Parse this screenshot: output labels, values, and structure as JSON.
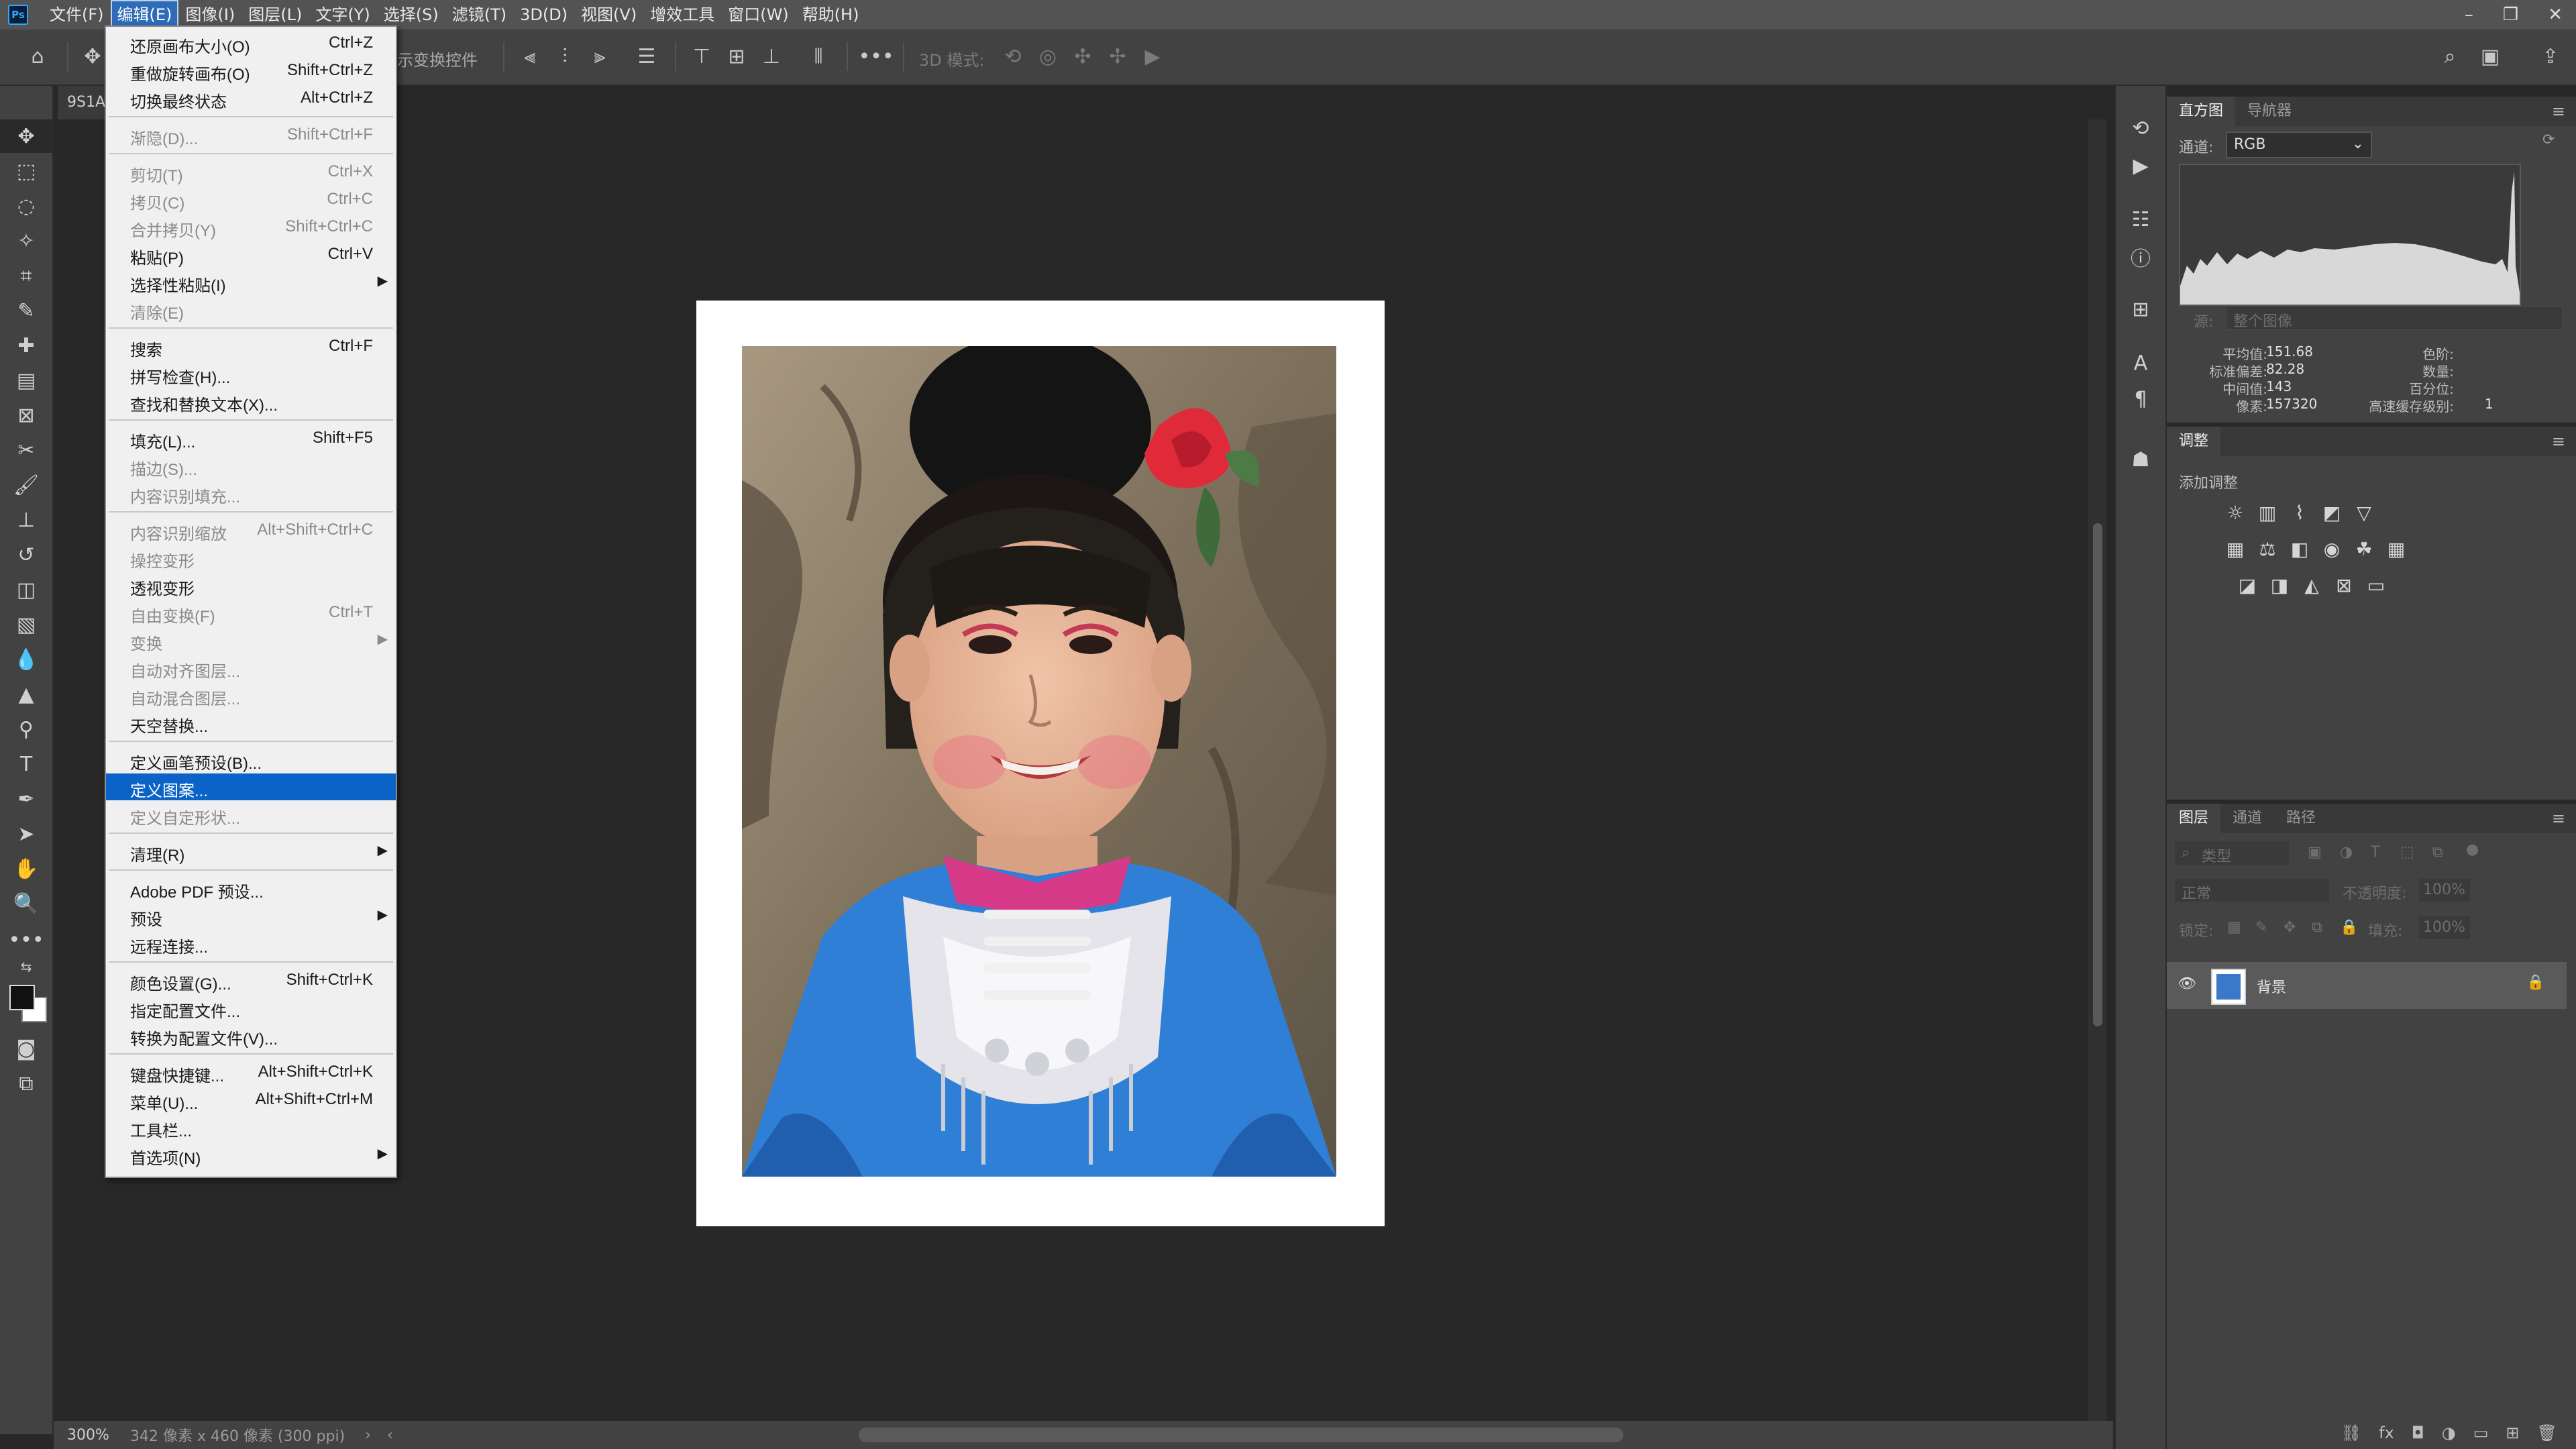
{
  "menubar": {
    "items": [
      "文件(F)",
      "编辑(E)",
      "图像(I)",
      "图层(L)",
      "文字(Y)",
      "选择(S)",
      "滤镜(T)",
      "3D(D)",
      "视图(V)",
      "增效工具",
      "窗口(W)",
      "帮助(H)"
    ],
    "active_index": 1
  },
  "options_bar": {
    "transform_controls_label": "示变换控件",
    "mode_3d_label": "3D 模式:"
  },
  "document": {
    "tab_label": "9S1A"
  },
  "status": {
    "zoom": "300%",
    "info": "342 像素 x 460 像素 (300 ppi)"
  },
  "histogram": {
    "tabs": [
      "直方图",
      "导航器"
    ],
    "channel_label": "通道:",
    "channel_value": "RGB",
    "source_label": "源:",
    "source_value": "整个图像",
    "stats_left": [
      {
        "label": "平均值:",
        "value": "151.68"
      },
      {
        "label": "标准偏差:",
        "value": "82.28"
      },
      {
        "label": "中间值:",
        "value": "143"
      },
      {
        "label": "像素:",
        "value": "157320"
      }
    ],
    "stats_right": [
      {
        "label": "色阶:",
        "value": ""
      },
      {
        "label": "数量:",
        "value": ""
      },
      {
        "label": "百分位:",
        "value": ""
      },
      {
        "label": "高速缓存级别:",
        "value": "1"
      }
    ]
  },
  "adjustments": {
    "title": "调整",
    "add_label": "添加调整"
  },
  "layers": {
    "tabs": [
      "图层",
      "通道",
      "路径"
    ],
    "filter_placeholder": "类型",
    "blend_mode": "正常",
    "opacity_label": "不透明度:",
    "opacity_value": "100%",
    "lock_label": "锁定:",
    "fill_label": "填充:",
    "fill_value": "100%",
    "items": [
      {
        "name": "背景",
        "locked": true,
        "visible": true
      }
    ]
  },
  "edit_menu": {
    "items": [
      {
        "label": "还原画布大小(O)",
        "shortcut": "Ctrl+Z",
        "disabled": false
      },
      {
        "label": "重做旋转画布(O)",
        "shortcut": "Shift+Ctrl+Z",
        "disabled": false
      },
      {
        "label": "切换最终状态",
        "shortcut": "Alt+Ctrl+Z",
        "disabled": false
      },
      {
        "sep": true
      },
      {
        "label": "渐隐(D)...",
        "shortcut": "Shift+Ctrl+F",
        "disabled": true
      },
      {
        "sep": true
      },
      {
        "label": "剪切(T)",
        "shortcut": "Ctrl+X",
        "disabled": true
      },
      {
        "label": "拷贝(C)",
        "shortcut": "Ctrl+C",
        "disabled": true
      },
      {
        "label": "合并拷贝(Y)",
        "shortcut": "Shift+Ctrl+C",
        "disabled": true
      },
      {
        "label": "粘贴(P)",
        "shortcut": "Ctrl+V",
        "disabled": false
      },
      {
        "label": "选择性粘贴(I)",
        "shortcut": "",
        "disabled": false,
        "submenu": true
      },
      {
        "label": "清除(E)",
        "shortcut": "",
        "disabled": true
      },
      {
        "sep": true
      },
      {
        "label": "搜索",
        "shortcut": "Ctrl+F",
        "disabled": false
      },
      {
        "label": "拼写检查(H)...",
        "shortcut": "",
        "disabled": false
      },
      {
        "label": "查找和替换文本(X)...",
        "shortcut": "",
        "disabled": false
      },
      {
        "sep": true
      },
      {
        "label": "填充(L)...",
        "shortcut": "Shift+F5",
        "disabled": false
      },
      {
        "label": "描边(S)...",
        "shortcut": "",
        "disabled": true
      },
      {
        "label": "内容识别填充...",
        "shortcut": "",
        "disabled": true
      },
      {
        "sep": true
      },
      {
        "label": "内容识别缩放",
        "shortcut": "Alt+Shift+Ctrl+C",
        "disabled": true
      },
      {
        "label": "操控变形",
        "shortcut": "",
        "disabled": true
      },
      {
        "label": "透视变形",
        "shortcut": "",
        "disabled": false
      },
      {
        "label": "自由变换(F)",
        "shortcut": "Ctrl+T",
        "disabled": true
      },
      {
        "label": "变换",
        "shortcut": "",
        "disabled": true,
        "submenu": true
      },
      {
        "label": "自动对齐图层...",
        "shortcut": "",
        "disabled": true
      },
      {
        "label": "自动混合图层...",
        "shortcut": "",
        "disabled": true
      },
      {
        "label": "天空替换...",
        "shortcut": "",
        "disabled": false
      },
      {
        "sep": true
      },
      {
        "label": "定义画笔预设(B)...",
        "shortcut": "",
        "disabled": false
      },
      {
        "label": "定义图案...",
        "shortcut": "",
        "disabled": false,
        "highlighted": true
      },
      {
        "label": "定义自定形状...",
        "shortcut": "",
        "disabled": true
      },
      {
        "sep": true
      },
      {
        "label": "清理(R)",
        "shortcut": "",
        "disabled": false,
        "submenu": true
      },
      {
        "sep": true
      },
      {
        "label": "Adobe PDF 预设...",
        "shortcut": "",
        "disabled": false
      },
      {
        "label": "预设",
        "shortcut": "",
        "disabled": false,
        "submenu": true
      },
      {
        "label": "远程连接...",
        "shortcut": "",
        "disabled": false
      },
      {
        "sep": true
      },
      {
        "label": "颜色设置(G)...",
        "shortcut": "Shift+Ctrl+K",
        "disabled": false
      },
      {
        "label": "指定配置文件...",
        "shortcut": "",
        "disabled": false
      },
      {
        "label": "转换为配置文件(V)...",
        "shortcut": "",
        "disabled": false
      },
      {
        "sep": true
      },
      {
        "label": "键盘快捷键...",
        "shortcut": "Alt+Shift+Ctrl+K",
        "disabled": false
      },
      {
        "label": "菜单(U)...",
        "shortcut": "Alt+Shift+Ctrl+M",
        "disabled": false
      },
      {
        "label": "工具栏...",
        "shortcut": "",
        "disabled": false
      },
      {
        "label": "首选项(N)",
        "shortcut": "",
        "disabled": false,
        "submenu": true
      }
    ]
  }
}
